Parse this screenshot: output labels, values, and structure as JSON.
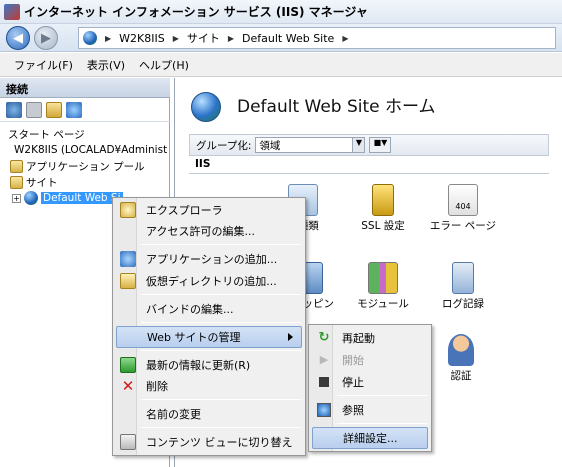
{
  "window": {
    "title": "インターネット インフォメーション サービス (IIS) マネージャ"
  },
  "address": {
    "crumbs": [
      "W2K8IIS",
      "サイト",
      "Default Web Site"
    ]
  },
  "menubar": {
    "items": [
      "ファイル(F)",
      "表示(V)",
      "ヘルプ(H)"
    ]
  },
  "connections": {
    "header": "接続",
    "tree": {
      "start_page": "スタート ページ",
      "server": "W2K8IIS (LOCALAD¥Administ",
      "app_pools": "アプリケーション プール",
      "sites": "サイト",
      "default_site": "Default Web Si"
    }
  },
  "main": {
    "title": "Default Web Site ホーム",
    "groupby_label": "グループ化:",
    "groupby_value": "領域",
    "section": "IIS",
    "features": [
      {
        "label": "の種類",
        "icon": "mime-types-icon"
      },
      {
        "label": "SSL 設定",
        "icon": "lock-icon"
      },
      {
        "label": "エラー ページ",
        "icon": "error-404-icon"
      },
      {
        "label": "マッピン",
        "icon": "handler-mappings-icon"
      },
      {
        "label": "モジュール",
        "icon": "modules-icon"
      },
      {
        "label": "ログ記録",
        "icon": "logging-icon"
      },
      {
        "label": "認証",
        "icon": "authentication-icon"
      }
    ],
    "error_badge": "404"
  },
  "context_menu": {
    "items": [
      {
        "label": "エクスプローラ",
        "icon": "explore-icon"
      },
      {
        "label": "アクセス許可の編集...",
        "icon": ""
      },
      {
        "label": "アプリケーションの追加...",
        "icon": "add-application-icon"
      },
      {
        "label": "仮想ディレクトリの追加...",
        "icon": "add-virtual-directory-icon"
      },
      {
        "label": "バインドの編集...",
        "icon": ""
      },
      {
        "label": "Web サイトの管理",
        "icon": ""
      },
      {
        "label": "最新の情報に更新(R)",
        "icon": "refresh-icon"
      },
      {
        "label": "削除",
        "icon": "delete-icon"
      },
      {
        "label": "名前の変更",
        "icon": ""
      },
      {
        "label": "コンテンツ ビューに切り替え",
        "icon": "content-view-icon"
      }
    ]
  },
  "submenu": {
    "items": [
      {
        "label": "再起動",
        "icon": "restart-icon"
      },
      {
        "label": "開始",
        "icon": "start-icon"
      },
      {
        "label": "停止",
        "icon": "stop-icon"
      },
      {
        "label": "参照",
        "icon": "browse-icon"
      },
      {
        "label": "詳細設定...",
        "icon": ""
      }
    ]
  }
}
